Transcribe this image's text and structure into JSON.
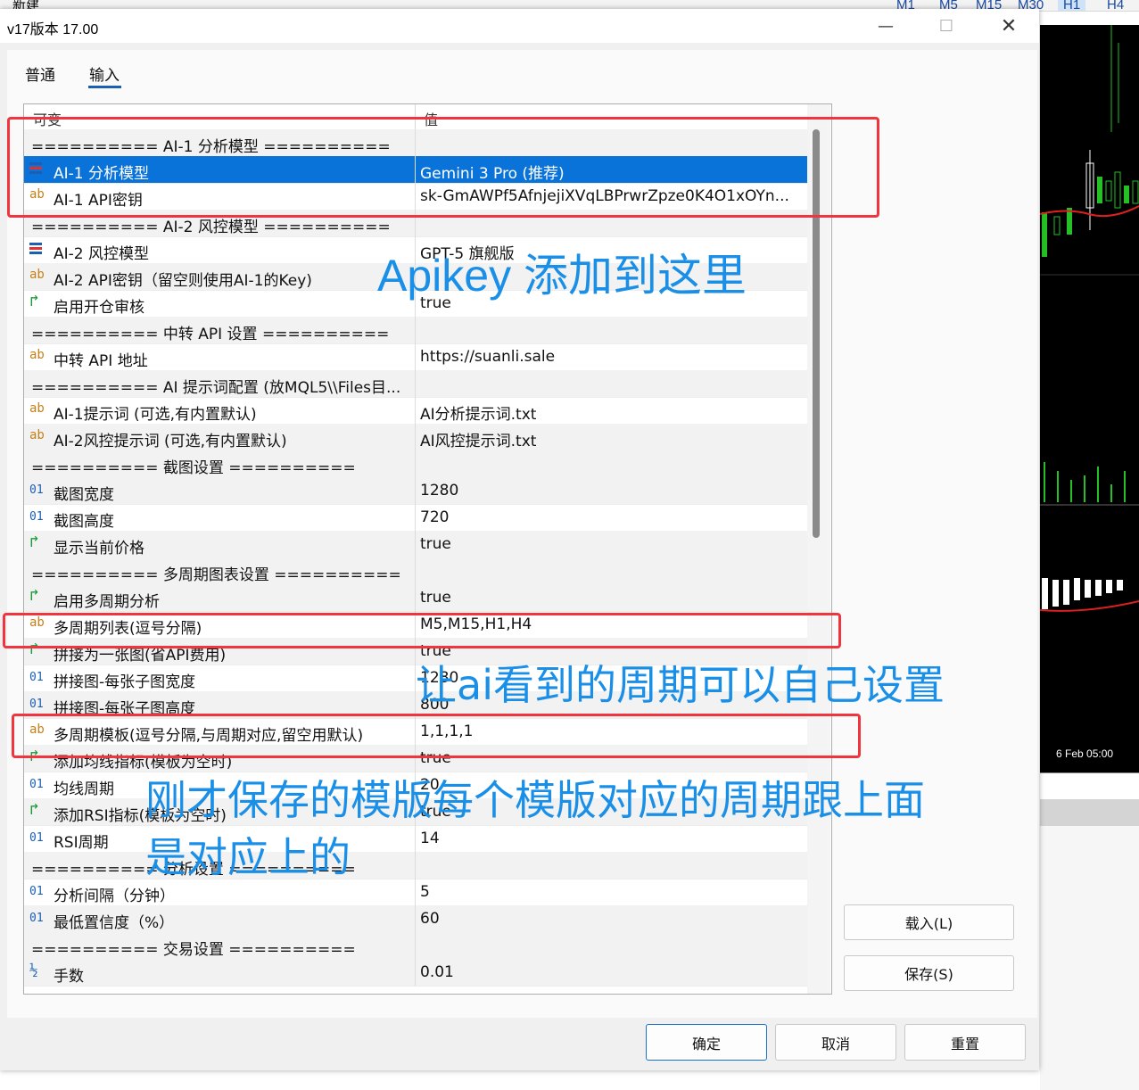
{
  "background_app": {
    "toolbar_label": "新建",
    "timeframes": [
      "M1",
      "M5",
      "M15",
      "M30",
      "H1",
      "H4"
    ],
    "active_timeframe": "H1",
    "chart_time_label": "6 Feb 05:00"
  },
  "dialog": {
    "title": "v17版本 17.00",
    "tabs": [
      "普通",
      "输入"
    ],
    "active_tab": "输入",
    "columns": {
      "name": "可变",
      "value": "值"
    },
    "rows": [
      {
        "type": "sep",
        "name": "========== AI-1 分析模型 ==========",
        "value": ""
      },
      {
        "type": "enum",
        "name": "AI-1 分析模型",
        "value": "Gemini 3 Pro (推荐)",
        "selected": true
      },
      {
        "type": "str",
        "name": "AI-1 API密钥",
        "value": "sk-GmAWPf5AfnjejiXVqLBPrwrZpze0K4O1xOYn..."
      },
      {
        "type": "sep",
        "name": "========== AI-2 风控模型 ==========",
        "value": ""
      },
      {
        "type": "enum",
        "name": "AI-2 风控模型",
        "value": "GPT-5 旗舰版"
      },
      {
        "type": "str",
        "name": "AI-2 API密钥（留空则使用AI-1的Key)",
        "value": ""
      },
      {
        "type": "bool",
        "name": "启用开仓审核",
        "value": "true"
      },
      {
        "type": "sep",
        "name": "========== 中转 API 设置 ==========",
        "value": ""
      },
      {
        "type": "str",
        "name": "中转 API 地址",
        "value": "https://suanli.sale"
      },
      {
        "type": "sep",
        "name": "========== AI 提示词配置 (放MQL5\\\\Files目...",
        "value": ""
      },
      {
        "type": "str",
        "name": "AI-1提示词 (可选,有内置默认)",
        "value": "AI分析提示词.txt"
      },
      {
        "type": "str",
        "name": "AI-2风控提示词 (可选,有内置默认)",
        "value": "AI风控提示词.txt"
      },
      {
        "type": "sep",
        "name": "========== 截图设置 ==========",
        "value": ""
      },
      {
        "type": "num",
        "name": "截图宽度",
        "value": "1280"
      },
      {
        "type": "num",
        "name": "截图高度",
        "value": "720"
      },
      {
        "type": "bool",
        "name": "显示当前价格",
        "value": "true"
      },
      {
        "type": "sep",
        "name": "========== 多周期图表设置 ==========",
        "value": ""
      },
      {
        "type": "bool",
        "name": "启用多周期分析",
        "value": "true"
      },
      {
        "type": "str",
        "name": "多周期列表(逗号分隔)",
        "value": "M5,M15,H1,H4"
      },
      {
        "type": "bool",
        "name": "拼接为一张图(省API费用)",
        "value": "true"
      },
      {
        "type": "num",
        "name": "拼接图-每张子图宽度",
        "value": "1280"
      },
      {
        "type": "num",
        "name": "拼接图-每张子图高度",
        "value": "800"
      },
      {
        "type": "str",
        "name": "多周期模板(逗号分隔,与周期对应,留空用默认)",
        "value": "1,1,1,1"
      },
      {
        "type": "bool",
        "name": "添加均线指标(模板为空时)",
        "value": "true"
      },
      {
        "type": "num",
        "name": "均线周期",
        "value": "20"
      },
      {
        "type": "bool",
        "name": "添加RSI指标(模板为空时)",
        "value": "true"
      },
      {
        "type": "num",
        "name": "RSI周期",
        "value": "14"
      },
      {
        "type": "sep",
        "name": "========== 分析设置 ==========",
        "value": ""
      },
      {
        "type": "num",
        "name": "分析间隔（分钟）",
        "value": "5"
      },
      {
        "type": "num",
        "name": "最低置信度（%）",
        "value": "60"
      },
      {
        "type": "sep",
        "name": "========== 交易设置 ==========",
        "value": ""
      },
      {
        "type": "frac",
        "name": "手数",
        "value": "0.01"
      }
    ],
    "buttons": {
      "load": "载入(L)",
      "save": "保存(S)",
      "ok": "确定",
      "cancel": "取消",
      "reset": "重置"
    }
  },
  "annotations": {
    "apikey_note": "Apikey 添加到这里",
    "period_note": "让ai看到的周期可以自己设置",
    "template_note_line1": "刚才保存的模版每个模版对应的周期跟上面",
    "template_note_line2": "是对应上的"
  },
  "colors": {
    "selection": "#0a73d9",
    "annotation": "#1a8fe8",
    "highlight_box": "#f0353f"
  }
}
